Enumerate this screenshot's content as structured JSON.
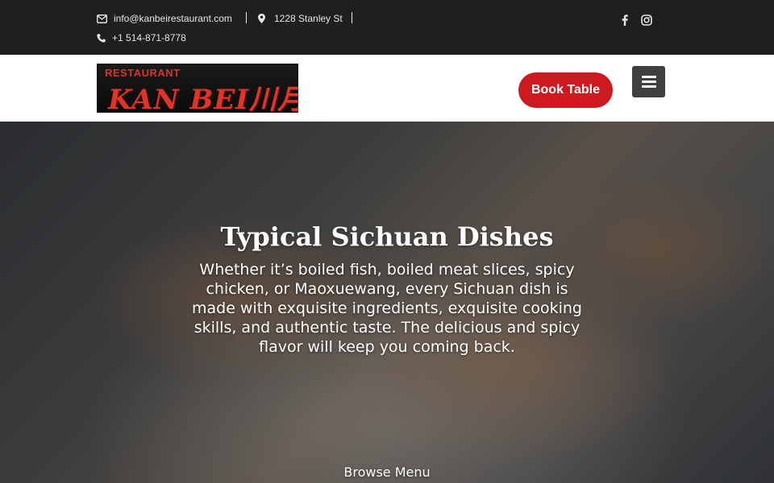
{
  "topbar": {
    "email": "info@kanbeirestaurant.com",
    "address": "1228 Stanley St",
    "phone": "+1 514-871-8778",
    "icons": {
      "email": "envelope-icon",
      "address": "map-marker-icon",
      "phone": "phone-icon",
      "facebook": "facebook-icon",
      "instagram": "instagram-icon"
    }
  },
  "header": {
    "logo_top": "RESTAURANT",
    "logo_main": "KAN BEI川月",
    "book_label": "Book Table",
    "menu_icon": "hamburger-menu-icon",
    "accent_color": "#cc1a1f"
  },
  "hero": {
    "title": "Typical Sichuan Dishes",
    "text": "Whether it’s boiled fish, boiled meat slices, spicy chicken, or Maoxuewang, every Sichuan dish is made with exquisite ingredients, exquisite cooking skills, and authentic taste. The delicious and spicy flavor will keep you coming back.",
    "browse_label": "Browse Menu"
  }
}
